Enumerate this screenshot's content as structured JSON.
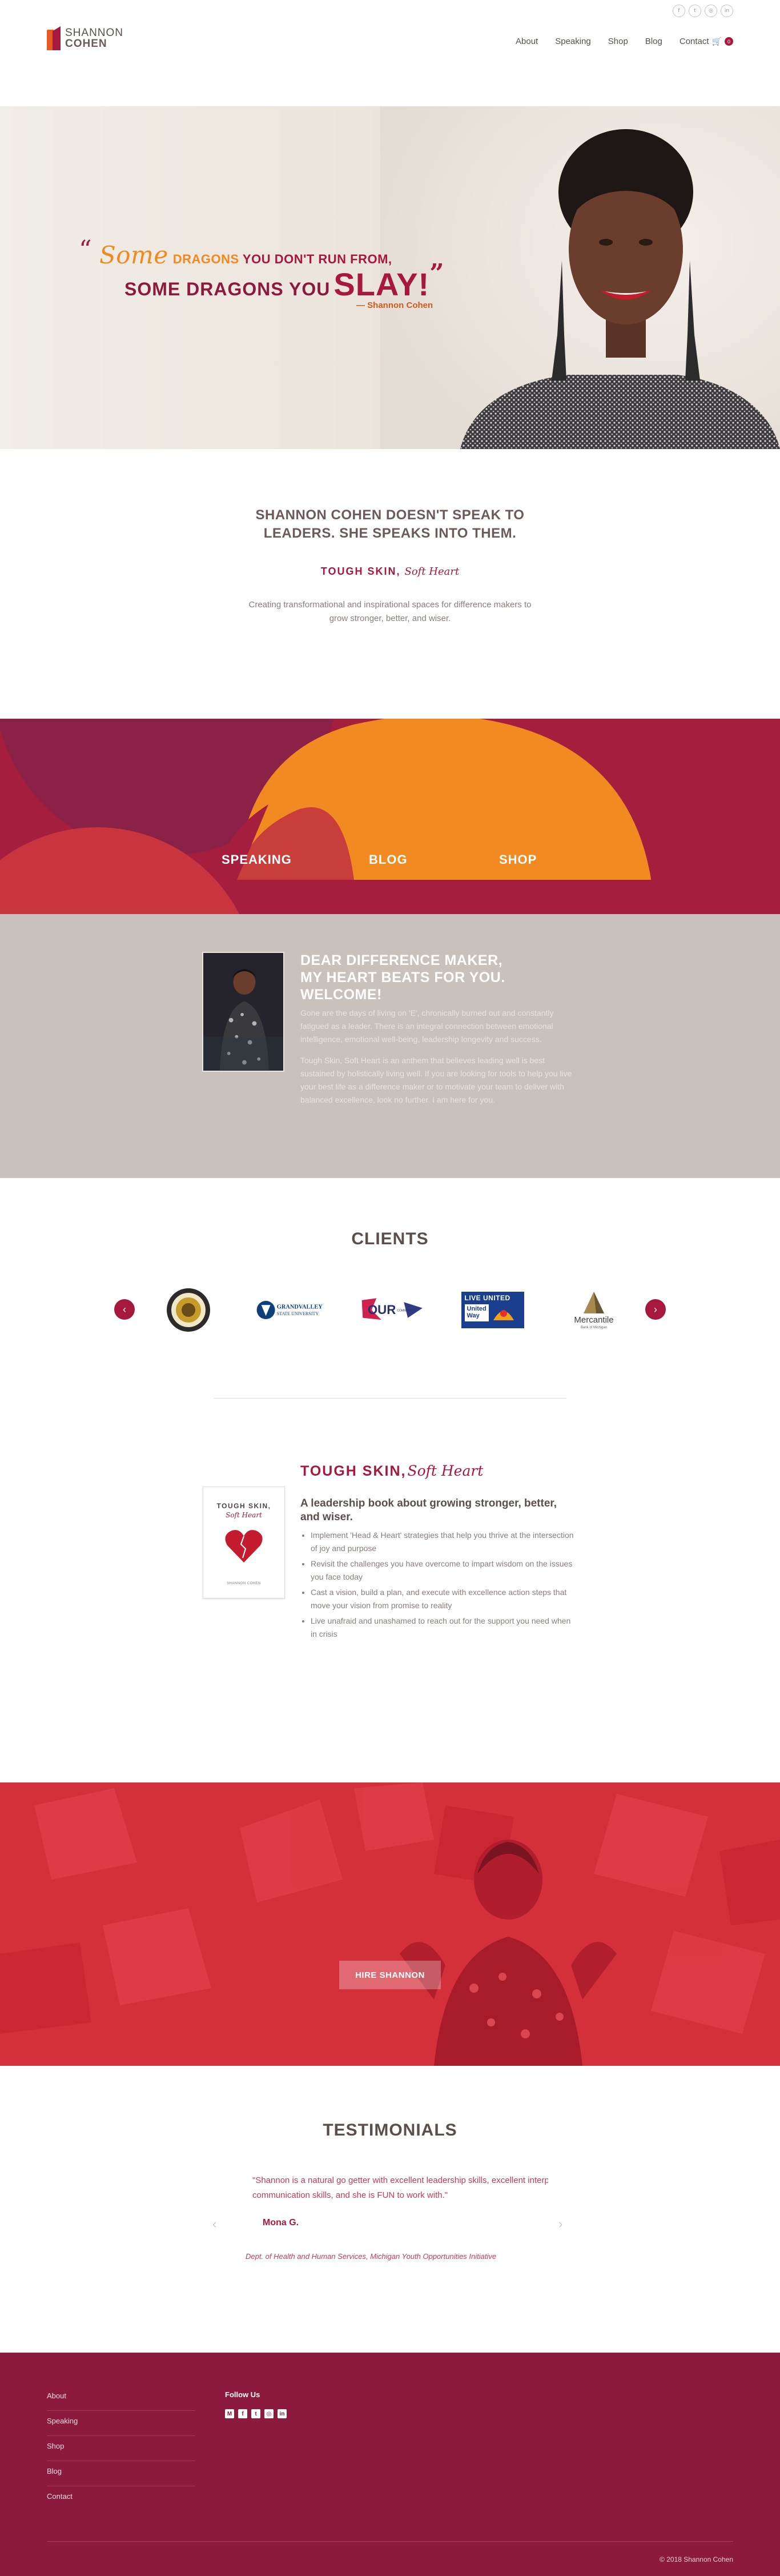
{
  "header": {
    "logo": {
      "line1": "SHANNON",
      "line2": "COHEN"
    },
    "socials": [
      {
        "icon": "facebook-icon",
        "glyph": "f"
      },
      {
        "icon": "twitter-icon",
        "glyph": "t"
      },
      {
        "icon": "instagram-icon",
        "glyph": "◎"
      },
      {
        "icon": "linkedin-icon",
        "glyph": "in"
      }
    ],
    "nav": {
      "about": "About",
      "speaking": "Speaking",
      "shop": "Shop",
      "blog": "Blog",
      "contact": "Contact",
      "cart_count": "0"
    }
  },
  "hero": {
    "quote_open": "“",
    "quote_some": "Some",
    "quote_dragons": "DRAGONS",
    "quote_line1_rest": "YOU DON'T RUN FROM,",
    "quote_line2": "SOME DRAGONS YOU",
    "quote_slay": "SLAY!",
    "quote_close": "”",
    "author": "— Shannon Cohen"
  },
  "intro": {
    "heading_line1": "SHANNON COHEN DOESN'T SPEAK TO",
    "heading_line2": "LEADERS. SHE SPEAKS INTO THEM.",
    "brand_a": "TOUGH SKIN,",
    "brand_b": "Soft Heart",
    "text": "Creating transformational and inspirational spaces for difference makers to grow stronger, better, and wiser."
  },
  "cta": {
    "speaking": "SPEAKING",
    "blog": "BLOG",
    "shop": "SHOP"
  },
  "welcome": {
    "heading_line1": "DEAR DIFFERENCE MAKER,",
    "heading_line2": "MY HEART BEATS FOR YOU.",
    "heading_line3": "WELCOME!",
    "p1": "Gone are the days of living on 'E', chronically burned out and constantly fatigued as a leader. There is an integral connection between emotional intelligence, emotional well-being, leadership longevity and success.",
    "p2": "Tough Skin, Soft Heart is an anthem that believes leading well is best sustained by holistically living well. If you are looking for tools to help you live your best life as a difference maker or to motivate your team to deliver with balanced excellence, look no further. I am here for you."
  },
  "clients": {
    "title": "CLIENTS",
    "prev": "‹",
    "next": "›",
    "logos": [
      {
        "name": "Seal"
      },
      {
        "name": "Grand Valley State University"
      },
      {
        "name": "OUR"
      },
      {
        "name": "Live United United Way",
        "l1": "LIVE UNITED",
        "l2": "United",
        "l3": "Way"
      },
      {
        "name": "Mercantile",
        "sub": "Bank of Michigan"
      }
    ]
  },
  "book": {
    "title_a": "TOUGH SKIN,",
    "title_b": "Soft Heart",
    "cover_t1": "TOUGH SKIN,",
    "cover_t2": "Soft Heart",
    "cover_author": "SHANNON COHEN",
    "subtitle": "A leadership book about growing stronger, better, and wiser.",
    "bullets": [
      "Implement 'Head & Heart' strategies that help you thrive at the intersection of joy and purpose",
      "Revisit the challenges you have overcome to impart wisdom on the issues you face today",
      "Cast a vision, build a plan, and execute with excellence action steps that move your vision from promise to reality",
      "Live unafraid and unashamed to reach out for the support you need when in crisis"
    ]
  },
  "hire": {
    "button": "HIRE SHANNON"
  },
  "testimonials": {
    "title": "TESTIMONIALS",
    "quote": "\"Shannon is a natural go getter with excellent leadership skills, excellent interpersonal communication skills, and she is FUN to work with.\"",
    "name": "Mona G.",
    "org": "Dept. of Health and Human Services, Michigan Youth Opportunities Initiative",
    "prev": "‹",
    "next": "›"
  },
  "footer": {
    "menu": [
      "About",
      "Speaking",
      "Shop",
      "Blog",
      "Contact"
    ],
    "follow": "Follow Us",
    "icons": [
      {
        "icon": "medium-icon",
        "glyph": "M"
      },
      {
        "icon": "facebook-icon",
        "glyph": "f"
      },
      {
        "icon": "twitter-icon",
        "glyph": "t"
      },
      {
        "icon": "instagram-icon",
        "glyph": "◎"
      },
      {
        "icon": "linkedin-icon",
        "glyph": "in"
      }
    ],
    "copyright": "© 2018 Shannon Cohen"
  },
  "colors": {
    "brand": "#a6193c",
    "accent": "#f08a20",
    "footer": "#8b1a3e",
    "welcome_bg": "#c9c1bb"
  }
}
